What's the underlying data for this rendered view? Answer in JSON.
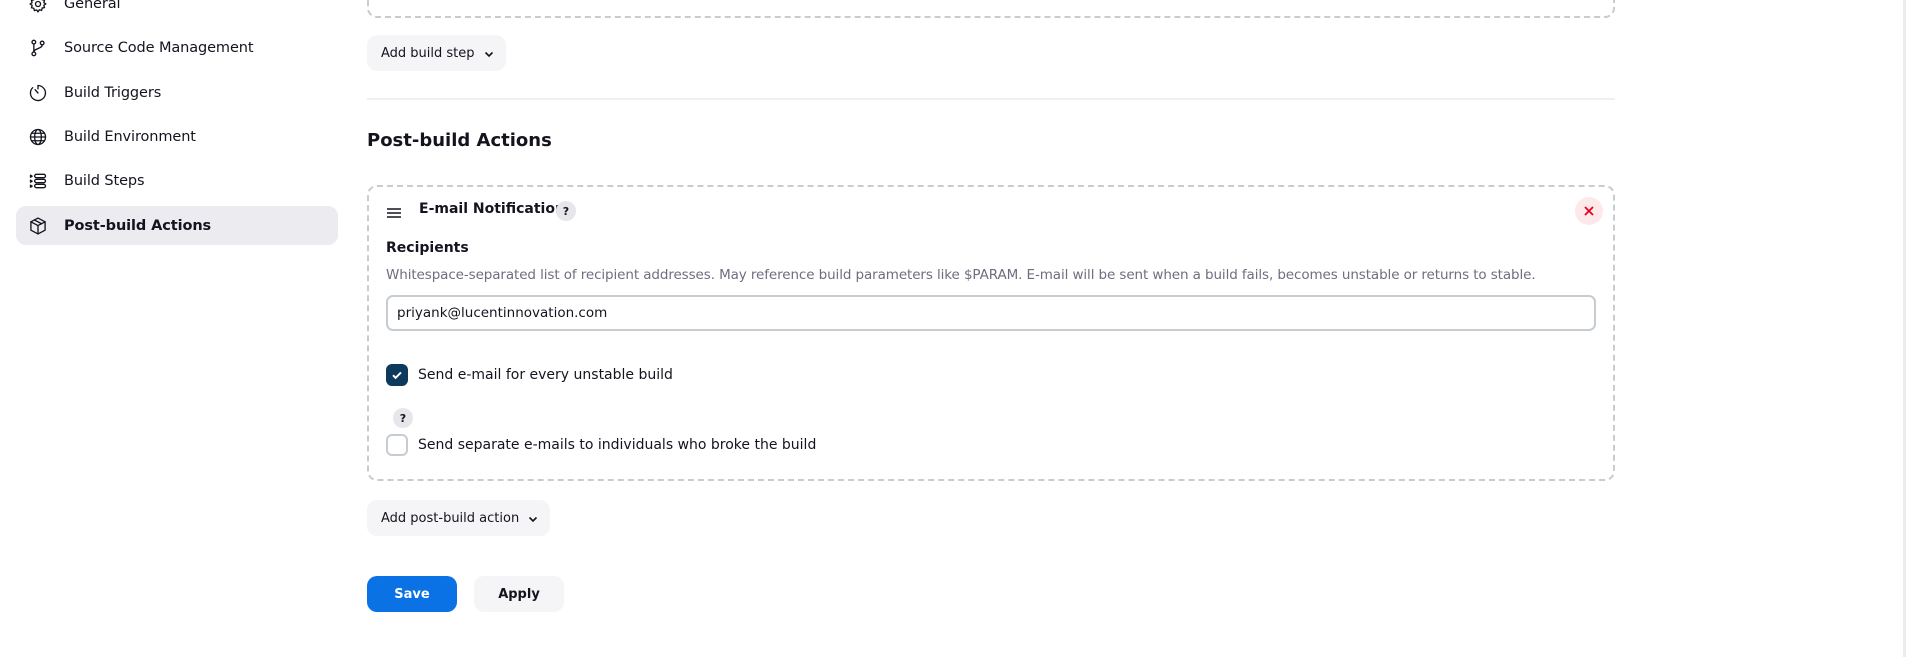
{
  "sidebar": {
    "items": [
      {
        "label": "General",
        "icon": "gear-icon",
        "active": false
      },
      {
        "label": "Source Code Management",
        "icon": "branch-icon",
        "active": false
      },
      {
        "label": "Build Triggers",
        "icon": "timer-icon",
        "active": false
      },
      {
        "label": "Build Environment",
        "icon": "globe-icon",
        "active": false
      },
      {
        "label": "Build Steps",
        "icon": "list-icon",
        "active": false
      },
      {
        "label": "Post-build Actions",
        "icon": "package-icon",
        "active": true
      }
    ]
  },
  "main": {
    "add_build_step_label": "Add build step",
    "section_title": "Post-build Actions",
    "email_card": {
      "title": "E-mail Notification",
      "help_label": "?",
      "recipients_label": "Recipients",
      "recipients_description": "Whitespace-separated list of recipient addresses. May reference build parameters like $PARAM. E-mail will be sent when a build fails, becomes unstable or returns to stable.",
      "recipients_value": "priyank@lucentinnovation.com",
      "options": [
        {
          "label": "Send e-mail for every unstable build",
          "checked": true
        },
        {
          "label": "Send separate e-mails to individuals who broke the build",
          "checked": false
        }
      ],
      "option_help_label": "?"
    },
    "add_post_build_label": "Add post-build action",
    "save_label": "Save",
    "apply_label": "Apply"
  },
  "colors": {
    "primary": "#0b72e5",
    "checkbox_checked": "#0b3a5e",
    "danger": "#e6001f",
    "active_sidebar_bg": "#ebebf0"
  }
}
